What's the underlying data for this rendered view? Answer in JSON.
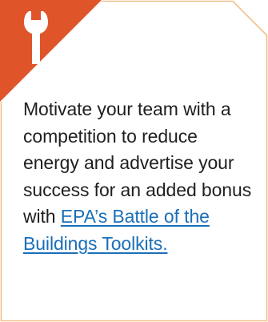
{
  "card": {
    "icon": "wrench-icon",
    "text_before_link": "Motivate your team with a competition to reduce energy and advertise your success for an added bonus with ",
    "link_text": "EPA’s Battle of the Buildings Toolkits.",
    "colors": {
      "accent": "#e0542a",
      "border": "#f2c08a",
      "text": "#1f1f1f",
      "link": "#1a6fb8"
    }
  }
}
